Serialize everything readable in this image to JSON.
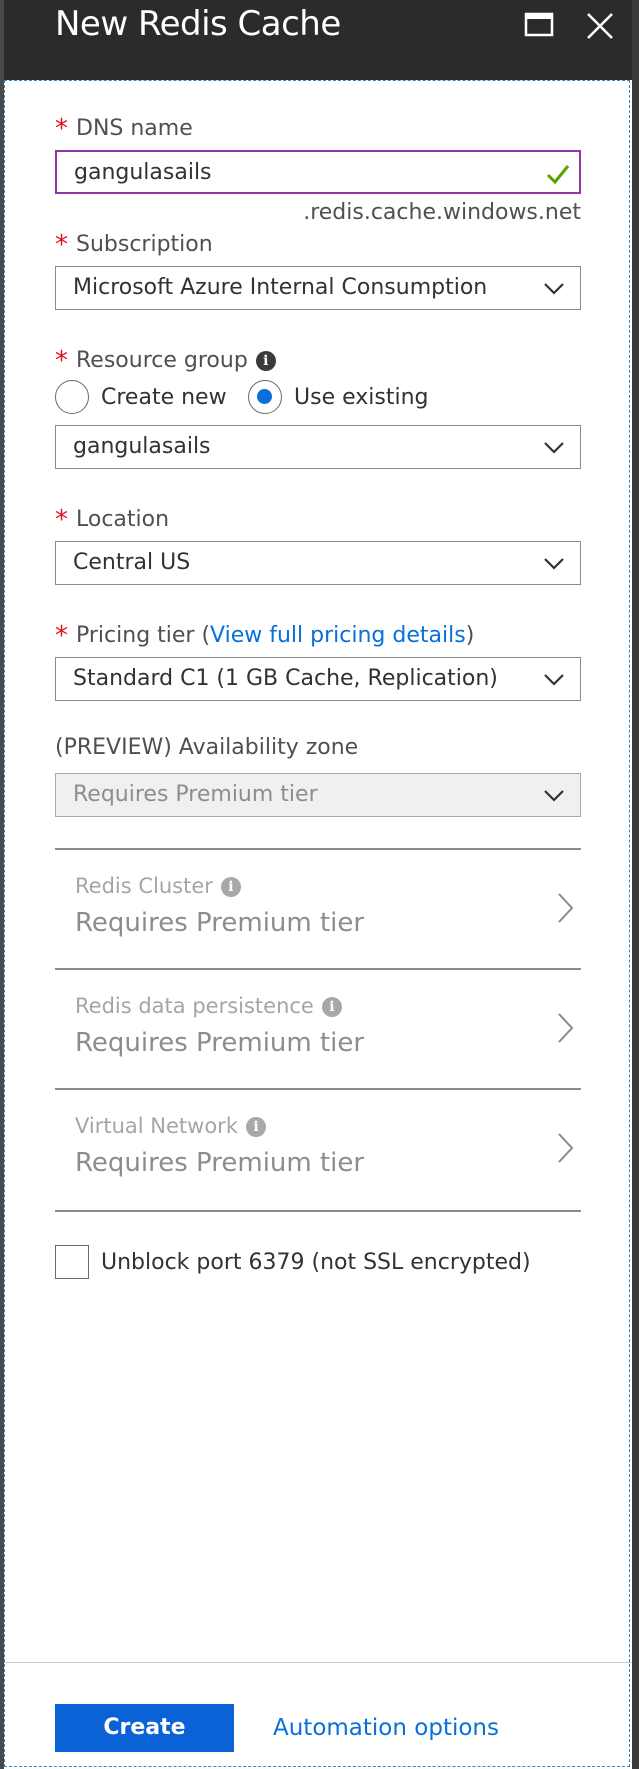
{
  "window": {
    "title": "New Redis Cache"
  },
  "dns": {
    "label": "DNS name",
    "value": "gangulasails",
    "suffix": ".redis.cache.windows.net",
    "valid": true
  },
  "subscription": {
    "label": "Subscription",
    "value": "Microsoft Azure Internal Consumption"
  },
  "resource_group": {
    "label": "Resource group",
    "options": [
      "Create new",
      "Use existing"
    ],
    "selected": "Use existing",
    "value": "gangulasails"
  },
  "location": {
    "label": "Location",
    "value": "Central US"
  },
  "pricing": {
    "label": "Pricing tier (",
    "link": "View full pricing details",
    "label_end": ")",
    "value": "Standard C1 (1 GB Cache, Replication)"
  },
  "availability_zone": {
    "label": "(PREVIEW) Availability zone",
    "value": "Requires Premium tier"
  },
  "sections": [
    {
      "title": "Redis Cluster",
      "value": "Requires Premium tier"
    },
    {
      "title": "Redis data persistence",
      "value": "Requires Premium tier"
    },
    {
      "title": "Virtual Network",
      "value": "Requires Premium tier"
    }
  ],
  "unblock_port": {
    "label": "Unblock port 6379 (not SSL encrypted)",
    "checked": false
  },
  "footer": {
    "create_label": "Create",
    "automation_label": "Automation options"
  },
  "colors": {
    "accent": "#0a62d6",
    "link": "#0a6fd8",
    "required": "#e0141e",
    "focus_border": "#8e35a8",
    "valid_check": "#57a300",
    "titlebar": "#2b2b2b"
  }
}
